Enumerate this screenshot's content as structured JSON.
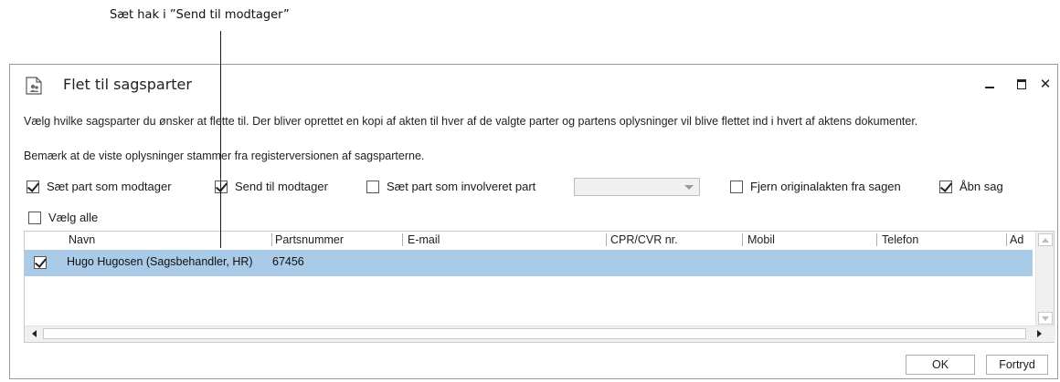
{
  "annotation": {
    "text": "Sæt hak i ”Send til modtager”"
  },
  "dialog": {
    "title": "Flet til sagsparter",
    "description1": "Vælg hvilke sagsparter du ønsker at flette til. Der bliver oprettet en kopi af akten til hver af de valgte parter og partens oplysninger vil blive flettet ind i hvert af aktens dokumenter.",
    "description2": "Bemærk at de viste oplysninger stammer fra registerversionen af sagsparterne."
  },
  "options": {
    "set_as_recipient": {
      "label": "Sæt part som modtager",
      "checked": true
    },
    "send_to_recipient": {
      "label": "Send til modtager",
      "checked": true
    },
    "set_as_involved": {
      "label": "Sæt part som involveret part",
      "checked": false
    },
    "involved_role_select": {
      "value": ""
    },
    "remove_original": {
      "label": "Fjern originalakten fra sagen",
      "checked": false
    },
    "open_case": {
      "label": "Åbn sag",
      "checked": true
    },
    "select_all": {
      "label": "Vælg alle",
      "checked": false
    }
  },
  "table": {
    "columns": [
      "Navn",
      "Partsnummer",
      "E-mail",
      "CPR/CVR nr.",
      "Mobil",
      "Telefon",
      "Ad"
    ],
    "rows": [
      {
        "checked": true,
        "name": "Hugo Hugosen (Sagsbehandler, HR)",
        "party_number": "67456",
        "email": "",
        "cpr": "",
        "mobile": "",
        "phone": "",
        "address": ""
      }
    ]
  },
  "buttons": {
    "ok": "OK",
    "cancel": "Fortryd"
  },
  "colors": {
    "selected_row": "#a9cbe8",
    "border": "#9a9a9a"
  }
}
